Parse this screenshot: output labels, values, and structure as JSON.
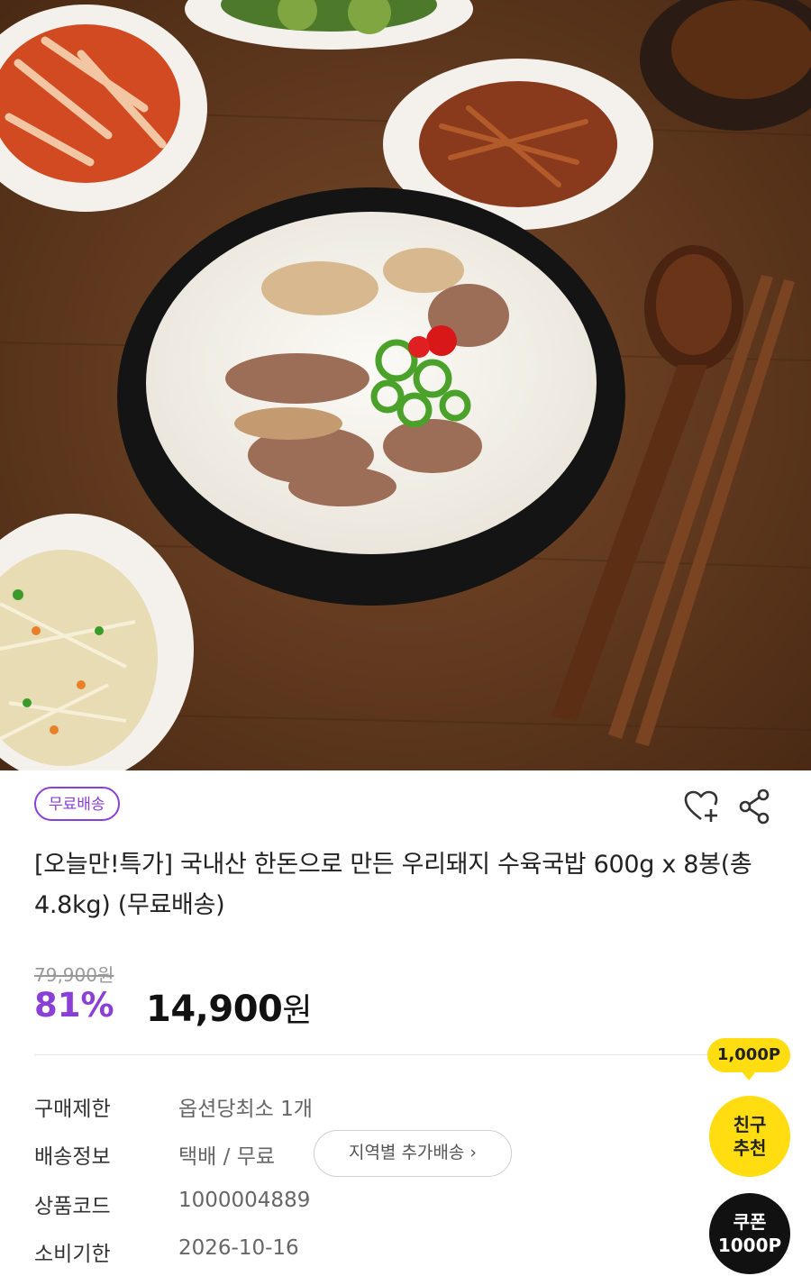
{
  "badge": {
    "free_shipping": "무료배송"
  },
  "icons": {
    "wishlist": "heart-plus-icon",
    "share": "share-icon"
  },
  "product": {
    "title": "[오늘만!특가] 국내산 한돈으로 만든 우리돼지 수육국밥 600g x 8봉(총 4.8kg) (무료배송)",
    "original_price": "79,900원",
    "discount": "81%",
    "price_number": "14,900",
    "price_unit": "원"
  },
  "info": {
    "purchase_limit": {
      "label": "구매제한",
      "value": "옵션당최소 1개"
    },
    "shipping": {
      "label": "배송정보",
      "value": "택배 / 무료",
      "button": "지역별 추가배송"
    },
    "product_code": {
      "label": "상품코드",
      "value": "1000004889"
    },
    "expiry": {
      "label": "소비기한",
      "value": "2026-10-16"
    }
  },
  "side": {
    "points": "1,000P",
    "friend_line1": "친구",
    "friend_line2": "추천",
    "coupon_line1": "쿠폰",
    "coupon_line2": "1000P"
  },
  "colors": {
    "accent": "#8a3fd6",
    "yellow": "#ffdd11",
    "dark": "#111111"
  }
}
